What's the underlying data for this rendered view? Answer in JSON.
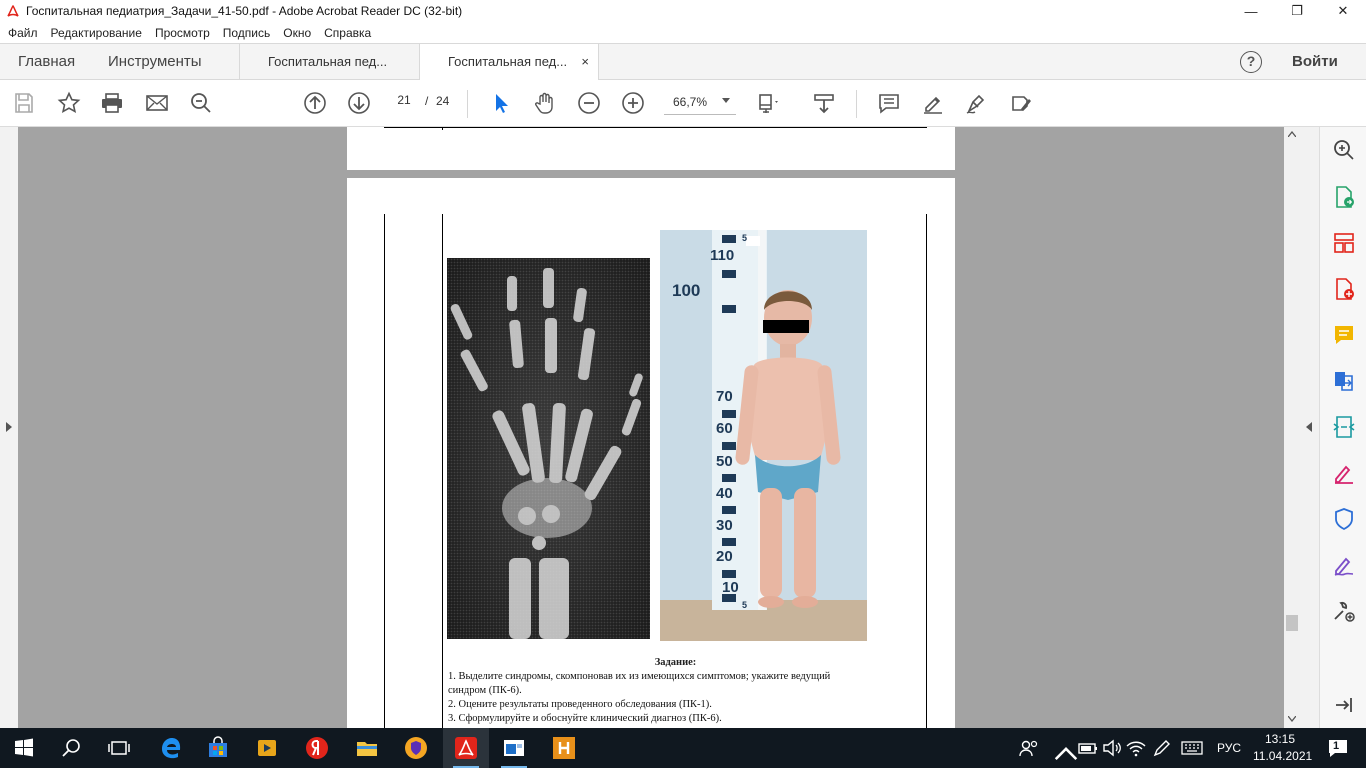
{
  "window": {
    "title": "Госпитальная педиатрия_Задачи_41-50.pdf - Adobe Acrobat Reader DC (32-bit)",
    "minimize": "—",
    "maximize": "❐",
    "close": "✕"
  },
  "menu": [
    "Файл",
    "Редактирование",
    "Просмотр",
    "Подпись",
    "Окно",
    "Справка"
  ],
  "tabs": {
    "home": "Главная",
    "tools": "Инструменты",
    "doc_inactive": "Госпитальная пед...",
    "doc_active": "Госпитальная пед...",
    "close": "×",
    "help": "?",
    "signin": "Войти"
  },
  "toolbar": {
    "page_current": "21",
    "page_sep": "/",
    "page_total": "24",
    "zoom": "66,7%"
  },
  "document": {
    "ruler_labels": [
      "5",
      "110",
      "100",
      "70",
      "60",
      "50",
      "40",
      "30",
      "20",
      "10",
      "5"
    ],
    "task_title": "Задание:",
    "task_lines": [
      "1. Выделите синдромы, скомпоновав их из имеющихся симптомов; укажите ведущий",
      "синдром (ПК-6).",
      "2. Оцените результаты проведенного обследования (ПК-1).",
      "3. Сформулируйте и обоснуйте клинический диагноз (ПК-6)."
    ]
  },
  "taskbar": {
    "lang": "РУС",
    "time": "13:15",
    "date": "11.04.2021",
    "notifications": "1"
  },
  "colors": {
    "accent_blue": "#1473e6",
    "acrobat_red": "#e1251b",
    "taskbar": "#101820",
    "doc_bg": "#a3a3a3"
  }
}
